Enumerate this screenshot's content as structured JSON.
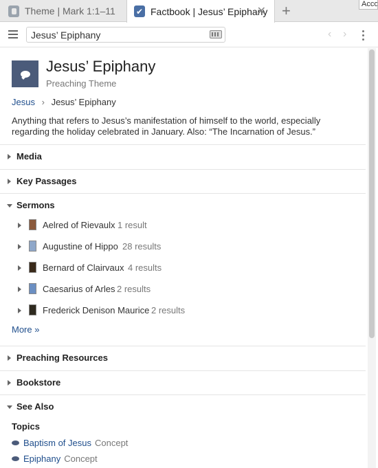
{
  "tabs": [
    {
      "label": "Theme | Mark 1:1–11",
      "active": false
    },
    {
      "label": "Factbook | Jesus’ Epiphany",
      "active": true
    }
  ],
  "acct_label": "Acco",
  "search": {
    "value": "Jesus’ Epiphany"
  },
  "header": {
    "title": "Jesus’ Epiphany",
    "subtitle": "Preaching Theme"
  },
  "breadcrumb": {
    "parent": "Jesus",
    "separator": "›",
    "current": "Jesus’ Epiphany"
  },
  "description": "Anything that refers to Jesus’s manifestation of himself to the world, especially regarding the holiday celebrated in January. Also: “The Incarnation of Jesus.”",
  "sections": {
    "media": "Media",
    "key_passages": "Key Passages",
    "sermons": "Sermons",
    "preaching_resources": "Preaching Resources",
    "bookstore": "Bookstore",
    "see_also": "See Also"
  },
  "sermons": [
    {
      "name": "Aelred of Rievaulx",
      "count": "1 result",
      "thumb_color": "#8b5a3c"
    },
    {
      "name": "Augustine of Hippo",
      "count": "28 results",
      "thumb_color": "#8fa7c9"
    },
    {
      "name": "Bernard of Clairvaux",
      "count": "4 results",
      "thumb_color": "#3a2a1a"
    },
    {
      "name": "Caesarius of Arles",
      "count": "2 results",
      "thumb_color": "#6b8fc2"
    },
    {
      "name": "Frederick Denison Maurice",
      "count": "2 results",
      "thumb_color": "#2f2a1f"
    }
  ],
  "more_label": "More »",
  "see_also": {
    "topics_heading": "Topics",
    "items": [
      {
        "name": "Baptism of Jesus",
        "kind": "Concept"
      },
      {
        "name": "Epiphany",
        "kind": "Concept"
      }
    ]
  },
  "colors": {
    "accent": "#1f4e8c",
    "header_icon": "#4b5b7a"
  }
}
